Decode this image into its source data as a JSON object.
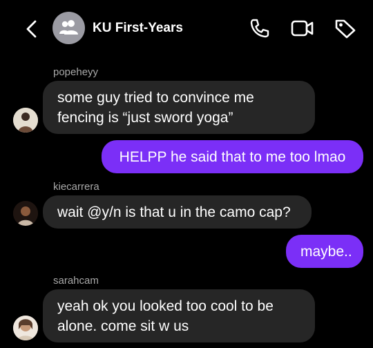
{
  "header": {
    "title": "KU First-Years",
    "back_icon": "chevron-left-icon",
    "group_icon": "group-icon",
    "call_icon": "phone-icon",
    "video_icon": "video-camera-icon",
    "tag_icon": "tag-icon"
  },
  "messages": [
    {
      "type": "incoming",
      "sender": "popeheyy",
      "lines": [
        "some guy tried to convince me",
        "fencing is “just sword yoga”"
      ]
    },
    {
      "type": "outgoing",
      "lines": [
        "HELPP he said that to me too lmao"
      ]
    },
    {
      "type": "incoming",
      "sender": "kiecarrera",
      "lines": [
        "wait @y/n is that u in the camo cap?"
      ]
    },
    {
      "type": "outgoing",
      "lines": [
        "maybe.."
      ]
    },
    {
      "type": "incoming",
      "sender": "sarahcam",
      "lines": [
        "yeah ok you looked too cool to be",
        "alone. come sit w us"
      ]
    }
  ],
  "colors": {
    "background": "#000000",
    "incoming_bubble": "#262626",
    "outgoing_bubble": "#7b2ff7",
    "sender_name": "#a8a8a8"
  }
}
